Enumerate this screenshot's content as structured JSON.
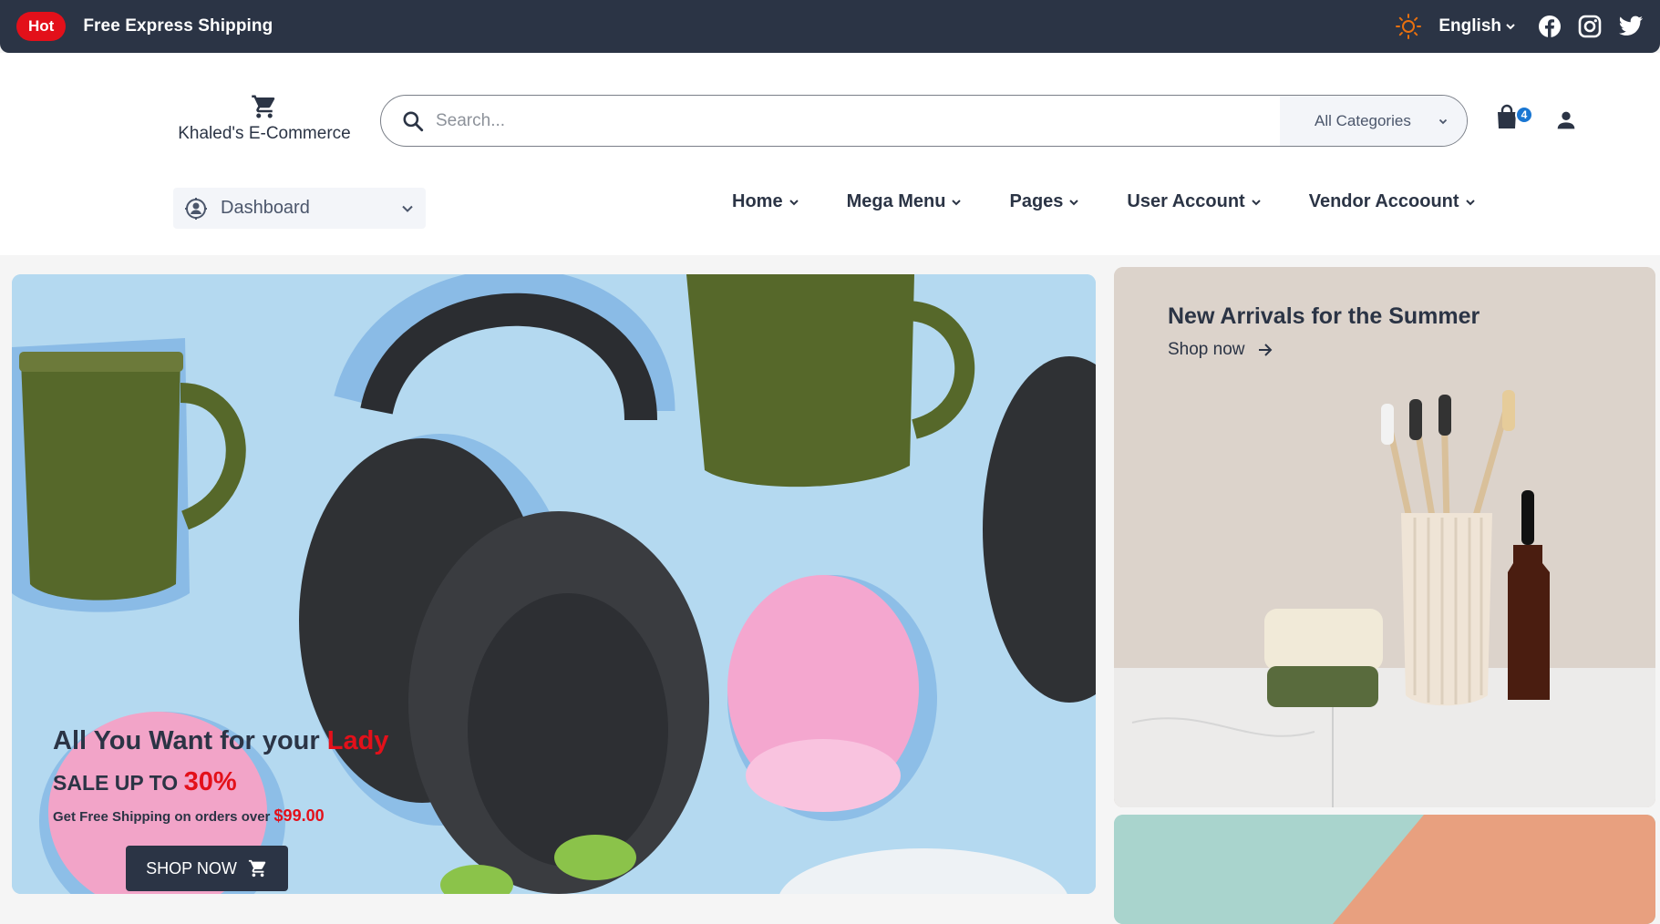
{
  "topbar": {
    "hot_badge": "Hot",
    "shipping_text": "Free Express Shipping",
    "language": "English"
  },
  "header": {
    "brand_name": "Khaled's E-Commerce",
    "search_placeholder": "Search...",
    "category_select": "All Categories",
    "cart_count": "4"
  },
  "nav": {
    "dashboard_label": "Dashboard",
    "items": [
      "Home",
      "Mega Menu",
      "Pages",
      "User Account",
      "Vendor Accoount"
    ]
  },
  "hero": {
    "headline_prefix": "All You Want for your ",
    "headline_highlight": "Lady",
    "sale_prefix": "SALE UP TO ",
    "sale_percent": "30%",
    "shipping_prefix": "Get Free Shipping on orders over ",
    "shipping_price": "$99.00",
    "button_label": "SHOP NOW"
  },
  "side_banner": {
    "title": "New Arrivals for the Summer",
    "link_label": "Shop now"
  },
  "colors": {
    "dark": "#2b3445",
    "accent_red": "#e3101a",
    "badge_blue": "#1976d2",
    "sun_orange": "#e8700f"
  }
}
